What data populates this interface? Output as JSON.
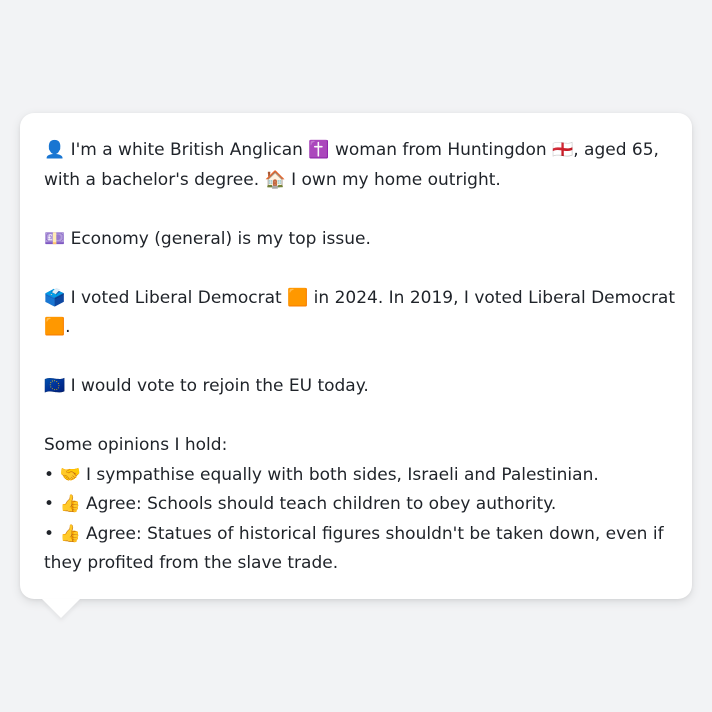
{
  "profile": {
    "intro": {
      "person_icon": "👤",
      "text_1": " I'm a white British Anglican ",
      "religion_icon": "✝️",
      "text_2": " woman from Huntingdon ",
      "flag_icon": "🏴󠁧󠁢󠁥󠁮󠁧󠁿",
      "text_3": ", aged 65, with a bachelor's degree. ",
      "home_icon": "🏠",
      "text_4": " I own my home outright."
    },
    "issue": {
      "icon": "💷",
      "text": " Economy (general) is my top issue."
    },
    "vote": {
      "icon": "🗳️",
      "text_1": " I voted Liberal Democrat ",
      "party_icon_1": "🟧",
      "text_2": " in 2024. In 2019, I voted Liberal Democrat ",
      "party_icon_2": "🟧",
      "text_3": "."
    },
    "eu": {
      "icon": "🇪🇺",
      "text": " I would vote to rejoin the EU today."
    },
    "opinions": {
      "heading": "Some opinions I hold:",
      "bullet": "•",
      "items": [
        {
          "icon": "🤝",
          "text": " I sympathise equally with both sides, Israeli and Palestinian."
        },
        {
          "icon": "👍",
          "text": " Agree: Schools should teach children to obey authority."
        },
        {
          "icon": "👍",
          "text": " Agree: Statues of historical figures shouldn't be taken down, even if they profited from the slave trade."
        }
      ]
    }
  }
}
